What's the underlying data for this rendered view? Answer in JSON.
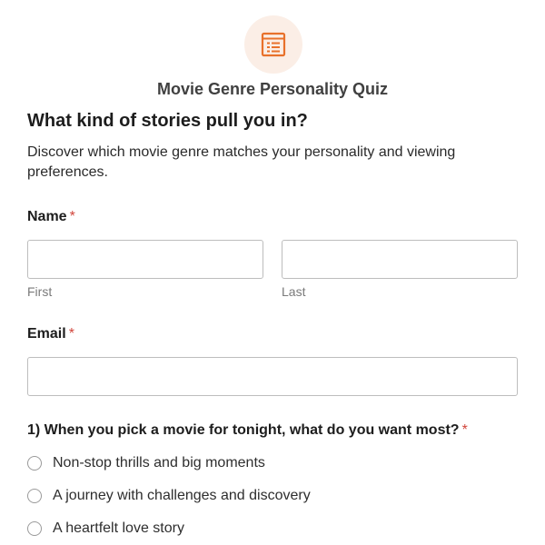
{
  "header": {
    "logo_icon": "document-list-icon",
    "accent_color": "#e8712b",
    "form_title": "Movie Genre Personality Quiz"
  },
  "intro": {
    "heading": "What kind of stories pull you in?",
    "description": "Discover which movie genre matches your personality and viewing preferences."
  },
  "name_field": {
    "label": "Name",
    "required_mark": "*",
    "first": {
      "value": "",
      "sublabel": "First"
    },
    "last": {
      "value": "",
      "sublabel": "Last"
    }
  },
  "email_field": {
    "label": "Email",
    "required_mark": "*",
    "value": ""
  },
  "question_1": {
    "label": "1) When you pick a movie for tonight, what do you want most?",
    "required_mark": "*",
    "options": [
      {
        "label": "Non-stop thrills and big moments",
        "selected": false
      },
      {
        "label": "A journey with challenges and discovery",
        "selected": false
      },
      {
        "label": "A heartfelt love story",
        "selected": false
      }
    ]
  }
}
